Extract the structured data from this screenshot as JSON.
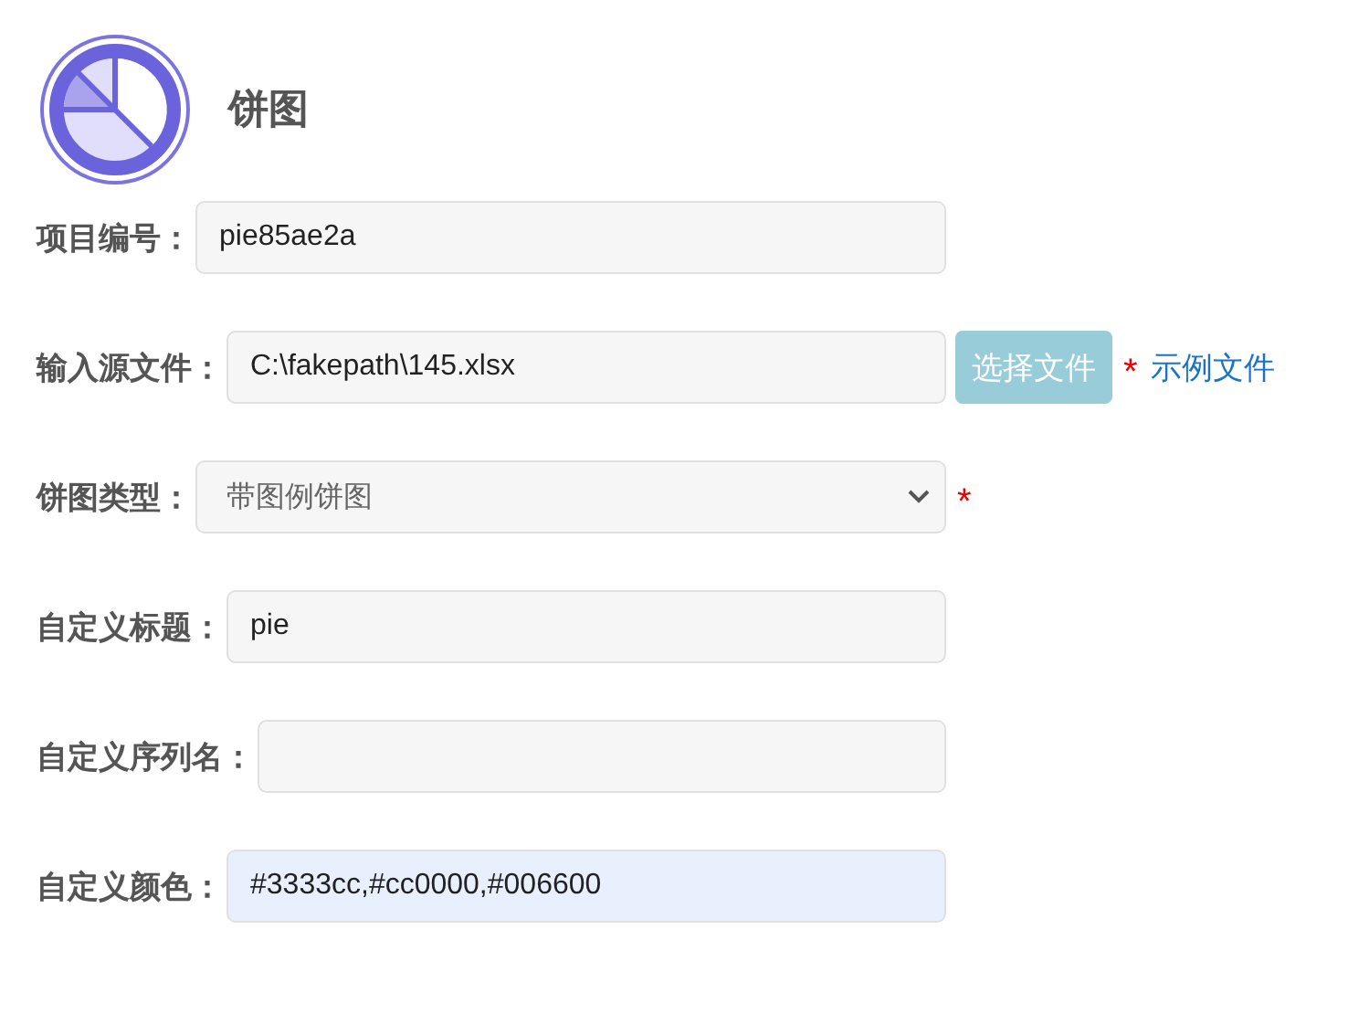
{
  "header": {
    "title": "饼图"
  },
  "fields": [
    {
      "label": "项目编号：",
      "kind": "input",
      "value": "pie85ae2a",
      "highlighted": false
    },
    {
      "label": "输入源文件：",
      "kind": "file",
      "value": "C:\\fakepath\\145.xlsx",
      "required_mark": "*",
      "highlighted": false,
      "button": "选择文件",
      "link": "示例文件"
    },
    {
      "label": "饼图类型：",
      "kind": "select",
      "value": "带图例饼图",
      "required_mark": "*",
      "highlighted": false
    },
    {
      "label": "自定义标题：",
      "kind": "input",
      "value": "pie",
      "highlighted": false
    },
    {
      "label": "自定义序列名：",
      "kind": "input",
      "highlighted": false
    },
    {
      "label": "自定义颜色：",
      "kind": "input",
      "value": "#3333cc,#cc0000,#006600",
      "highlighted": true
    }
  ]
}
